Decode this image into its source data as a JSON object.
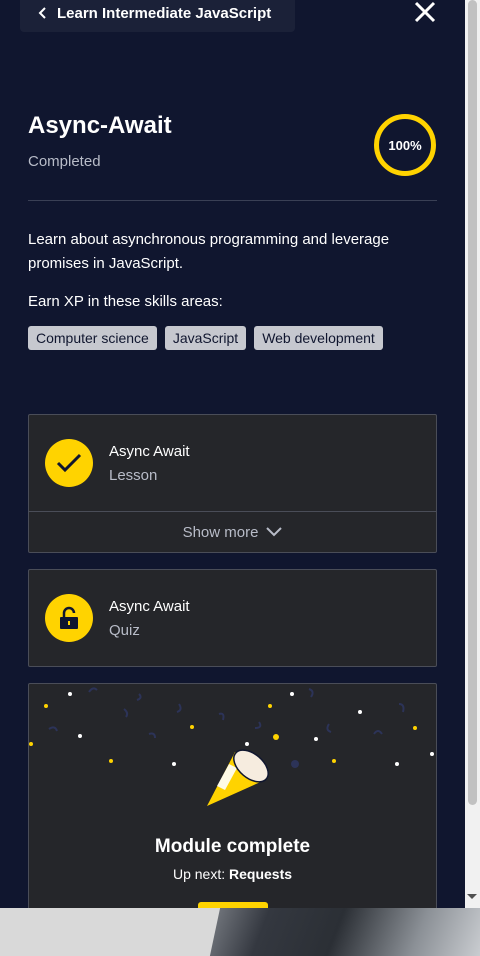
{
  "header": {
    "back_label": "Learn Intermediate JavaScript"
  },
  "module": {
    "title": "Async-Await",
    "status": "Completed",
    "progress": "100%",
    "progress_fraction": 1.0,
    "description": "Learn about asynchronous programming and leverage promises in JavaScript.",
    "earn_label": "Earn XP in these skills areas:",
    "skills": [
      "Computer science",
      "JavaScript",
      "Web development"
    ]
  },
  "items": [
    {
      "title": "Async Await",
      "type": "Lesson",
      "icon": "check-icon"
    },
    {
      "title": "Async Await",
      "type": "Quiz",
      "icon": "unlock-icon"
    }
  ],
  "show_more_label": "Show more",
  "complete": {
    "title": "Module complete",
    "up_next_prefix": "Up next:",
    "up_next_name": "Requests"
  },
  "colors": {
    "background": "#10162f",
    "accent": "#ffd300",
    "card": "#25262a"
  }
}
